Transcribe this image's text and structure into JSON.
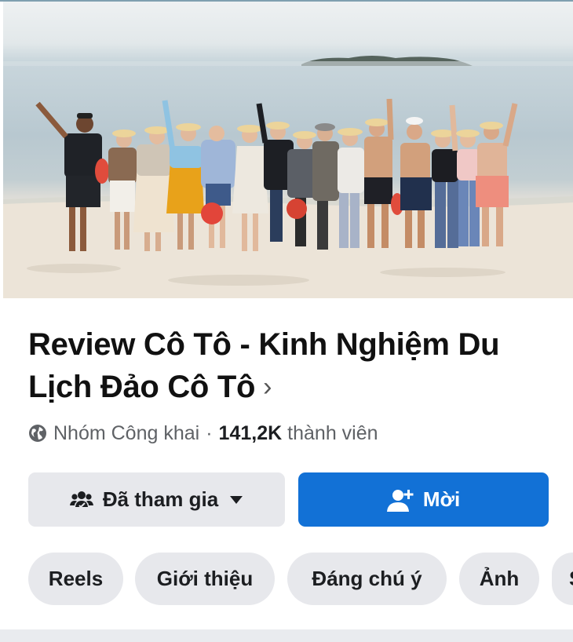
{
  "group": {
    "title": "Review Cô Tô - Kinh Nghiệm Du Lịch Đảo Cô Tô",
    "title_chevron": "›",
    "privacy": "Nhóm Công khai",
    "separator": "·",
    "member_count": "141,2K",
    "member_label": "thành viên"
  },
  "actions": {
    "joined_label": "Đã tham gia",
    "invite_label": "Mời"
  },
  "tabs": [
    "Reels",
    "Giới thiệu",
    "Đáng chú ý",
    "Ảnh",
    "S"
  ],
  "icons": {
    "privacy": "globe-icon",
    "joined": "group-people-icon",
    "dropdown": "caret-down-icon",
    "invite": "add-person-icon",
    "title_more": "chevron-right-icon"
  },
  "colors": {
    "primary": "#1271d6",
    "button_gray": "#e7e8ec",
    "text_secondary": "#5f6266"
  }
}
